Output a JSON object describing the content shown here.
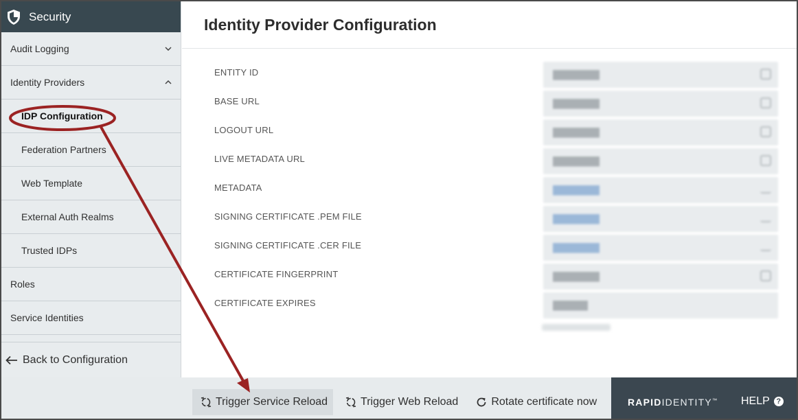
{
  "sidebar": {
    "header": "Security",
    "items": [
      {
        "label": "Audit Logging"
      },
      {
        "label": "Identity Providers"
      },
      {
        "label": "IDP Configuration"
      },
      {
        "label": "Federation Partners"
      },
      {
        "label": "Web Template"
      },
      {
        "label": "External Auth Realms"
      },
      {
        "label": "Trusted IDPs"
      },
      {
        "label": "Roles"
      },
      {
        "label": "Service Identities"
      }
    ],
    "back_label": "Back to Configuration"
  },
  "main": {
    "title": "Identity Provider Configuration",
    "fields": [
      {
        "label": "ENTITY ID"
      },
      {
        "label": "BASE URL"
      },
      {
        "label": "LOGOUT URL"
      },
      {
        "label": "LIVE METADATA URL"
      },
      {
        "label": "METADATA"
      },
      {
        "label": "SIGNING CERTIFICATE .PEM FILE"
      },
      {
        "label": "SIGNING CERTIFICATE .CER FILE"
      },
      {
        "label": "CERTIFICATE FINGERPRINT"
      },
      {
        "label": "CERTIFICATE EXPIRES"
      }
    ]
  },
  "actions": {
    "trigger_service_reload": "Trigger Service Reload",
    "trigger_web_reload": "Trigger Web Reload",
    "rotate_certificate": "Rotate certificate now"
  },
  "brand": {
    "part1": "RAPID",
    "part2": "IDENTITY",
    "tm": "™",
    "help_label": "HELP",
    "help_icon": "?"
  },
  "colors": {
    "sidebar_header": "#384850",
    "brand_bar": "#3b4750",
    "annotation_red": "#9b2323"
  },
  "icons": {
    "header": "shield-icon",
    "expand": "chevron-down-icon",
    "collapse": "chevron-up-icon",
    "back": "arrow-left-icon",
    "reload": "reload-icon",
    "rotate": "rotate-icon",
    "help": "help-circle-icon"
  }
}
